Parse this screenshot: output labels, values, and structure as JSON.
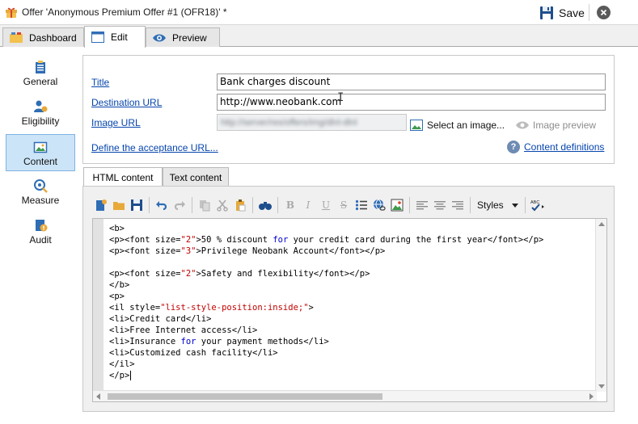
{
  "window": {
    "title": "Offer 'Anonymous Premium Offer #1 (OFR18)' *",
    "save_label": "Save",
    "icons": {
      "app": "gift-icon",
      "save": "floppy-disk-icon",
      "close": "close-circle-icon"
    }
  },
  "tabs": [
    {
      "label": "Dashboard",
      "icon": "dashboard-icon",
      "active": false
    },
    {
      "label": "Edit",
      "icon": "edit-window-icon",
      "active": true
    },
    {
      "label": "Preview",
      "icon": "eye-icon",
      "active": false
    }
  ],
  "sidebar": {
    "items": [
      {
        "label": "General",
        "icon": "general-icon",
        "active": false
      },
      {
        "label": "Eligibility",
        "icon": "eligibility-icon",
        "active": false
      },
      {
        "label": "Content",
        "icon": "content-image-icon",
        "active": true
      },
      {
        "label": "Measure",
        "icon": "measure-icon",
        "active": false
      },
      {
        "label": "Audit",
        "icon": "audit-icon",
        "active": false
      }
    ]
  },
  "form": {
    "title_label": "Title",
    "title_value": "Bank charges discount",
    "destination_label": "Destination URL",
    "destination_value": "http://www.neobank.com",
    "image_label": "Image URL",
    "image_value": "http://server/res/offers/img/dlnl-dlnl",
    "select_image_label": "Select an image...",
    "image_preview_label": "Image preview",
    "acceptance_label": "Define the acceptance URL...",
    "content_defs_label": "Content definitions"
  },
  "content_tabs": [
    {
      "label": "HTML content",
      "active": true
    },
    {
      "label": "Text content",
      "active": false
    }
  ],
  "editor": {
    "styles_label": "Styles",
    "format_buttons": {
      "bold": "B",
      "italic": "I",
      "underline": "U",
      "strike": "S"
    },
    "lines": [
      {
        "parts": [
          {
            "t": "<b>",
            "c": "tag"
          }
        ]
      },
      {
        "parts": [
          {
            "t": "<p><font size=",
            "c": "tag"
          },
          {
            "t": "\"2\"",
            "c": "str"
          },
          {
            "t": ">50 % discount ",
            "c": "tag"
          },
          {
            "t": "for",
            "c": "kw"
          },
          {
            "t": " your credit card during the first year</font></p>",
            "c": "tag"
          }
        ]
      },
      {
        "parts": [
          {
            "t": "<p><font size=",
            "c": "tag"
          },
          {
            "t": "\"3\"",
            "c": "str"
          },
          {
            "t": ">Privilege Neobank Account</font></p>",
            "c": "tag"
          }
        ]
      },
      {
        "parts": [
          {
            "t": "",
            "c": "tag"
          }
        ]
      },
      {
        "parts": [
          {
            "t": "<p><font size=",
            "c": "tag"
          },
          {
            "t": "\"2\"",
            "c": "str"
          },
          {
            "t": ">Safety and flexibility</font></p>",
            "c": "tag"
          }
        ]
      },
      {
        "parts": [
          {
            "t": "</b>",
            "c": "tag"
          }
        ]
      },
      {
        "parts": [
          {
            "t": "<p>",
            "c": "tag"
          }
        ]
      },
      {
        "parts": [
          {
            "t": "<il style=",
            "c": "tag"
          },
          {
            "t": "\"list-style-position:inside;\"",
            "c": "str"
          },
          {
            "t": ">",
            "c": "tag"
          }
        ]
      },
      {
        "parts": [
          {
            "t": "<li>Credit card</li>",
            "c": "tag"
          }
        ]
      },
      {
        "parts": [
          {
            "t": "<li>Free Internet access</li>",
            "c": "tag"
          }
        ]
      },
      {
        "parts": [
          {
            "t": "<li>Insurance ",
            "c": "tag"
          },
          {
            "t": "for",
            "c": "kw"
          },
          {
            "t": " your payment methods</li>",
            "c": "tag"
          }
        ]
      },
      {
        "parts": [
          {
            "t": "<li>Customized cash facility</li>",
            "c": "tag"
          }
        ]
      },
      {
        "parts": [
          {
            "t": "</il>",
            "c": "tag"
          }
        ]
      },
      {
        "parts": [
          {
            "t": "</p>",
            "c": "tag"
          }
        ]
      }
    ]
  },
  "colors": {
    "link": "#0645ad",
    "active_side": "#cce4f7",
    "keyword": "#0000cc",
    "string": "#c00000"
  }
}
